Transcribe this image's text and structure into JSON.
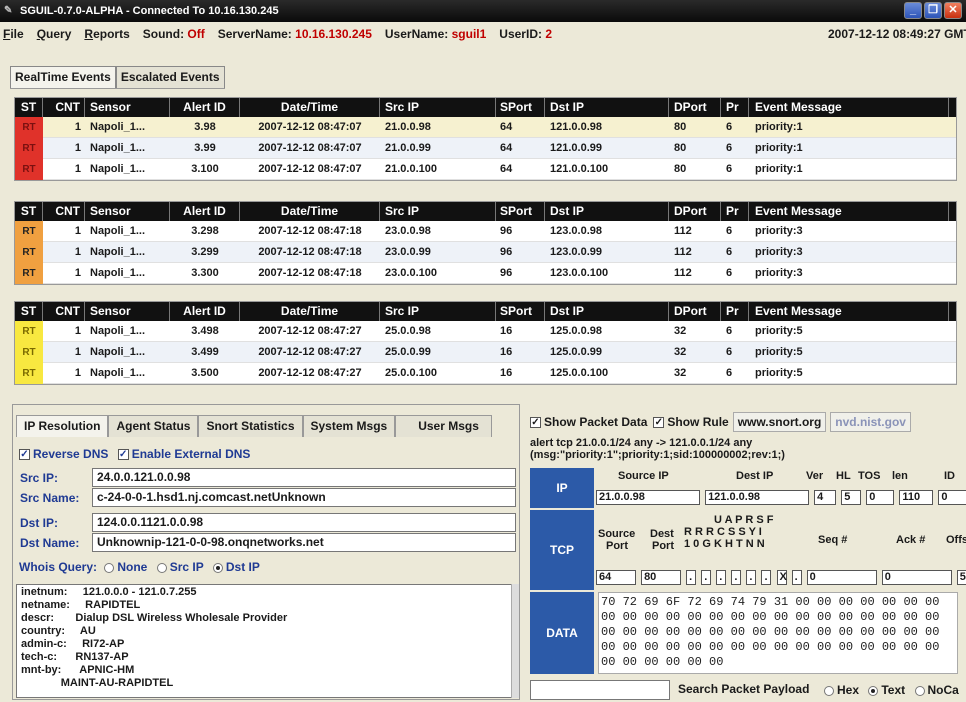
{
  "window": {
    "title": "SGUIL-0.7.0-ALPHA - Connected To 10.16.130.245"
  },
  "menu": {
    "file": "ile",
    "file_u": "F",
    "query": "uery",
    "query_u": "Q",
    "reports": "eports",
    "reports_u": "R",
    "sound_label": "Sound:",
    "sound_value": "Off",
    "server_label": "ServerName:",
    "server_value": "10.16.130.245",
    "user_label": "UserName:",
    "user_value": "sguil1",
    "userid_label": "UserID:",
    "userid_value": "2",
    "clock": "2007-12-12 08:49:27 GMT"
  },
  "tabs": [
    "RealTime Events",
    "Escalated Events"
  ],
  "columns": [
    "ST",
    "CNT",
    "Sensor",
    "Alert ID",
    "Date/Time",
    "Src IP",
    "SPort",
    "Dst IP",
    "DPort",
    "Pr",
    "Event Message"
  ],
  "panes": [
    {
      "color": "#e0322a",
      "rows": [
        {
          "st": "RT",
          "cnt": "1",
          "sensor": "Napoli_1...",
          "alert": "3.98",
          "date": "2007-12-12 08:47:07",
          "src": "21.0.0.98",
          "sport": "64",
          "dst": "121.0.0.98",
          "dport": "80",
          "pr": "6",
          "msg": "priority:1"
        },
        {
          "st": "RT",
          "cnt": "1",
          "sensor": "Napoli_1...",
          "alert": "3.99",
          "date": "2007-12-12 08:47:07",
          "src": "21.0.0.99",
          "sport": "64",
          "dst": "121.0.0.99",
          "dport": "80",
          "pr": "6",
          "msg": "priority:1"
        },
        {
          "st": "RT",
          "cnt": "1",
          "sensor": "Napoli_1...",
          "alert": "3.100",
          "date": "2007-12-12 08:47:07",
          "src": "21.0.0.100",
          "sport": "64",
          "dst": "121.0.0.100",
          "dport": "80",
          "pr": "6",
          "msg": "priority:1"
        }
      ]
    },
    {
      "color": "#f0a040",
      "rows": [
        {
          "st": "RT",
          "cnt": "1",
          "sensor": "Napoli_1...",
          "alert": "3.298",
          "date": "2007-12-12 08:47:18",
          "src": "23.0.0.98",
          "sport": "96",
          "dst": "123.0.0.98",
          "dport": "112",
          "pr": "6",
          "msg": "priority:3"
        },
        {
          "st": "RT",
          "cnt": "1",
          "sensor": "Napoli_1...",
          "alert": "3.299",
          "date": "2007-12-12 08:47:18",
          "src": "23.0.0.99",
          "sport": "96",
          "dst": "123.0.0.99",
          "dport": "112",
          "pr": "6",
          "msg": "priority:3"
        },
        {
          "st": "RT",
          "cnt": "1",
          "sensor": "Napoli_1...",
          "alert": "3.300",
          "date": "2007-12-12 08:47:18",
          "src": "23.0.0.100",
          "sport": "96",
          "dst": "123.0.0.100",
          "dport": "112",
          "pr": "6",
          "msg": "priority:3"
        }
      ]
    },
    {
      "color": "#f8e840",
      "rows": [
        {
          "st": "RT",
          "cnt": "1",
          "sensor": "Napoli_1...",
          "alert": "3.498",
          "date": "2007-12-12 08:47:27",
          "src": "25.0.0.98",
          "sport": "16",
          "dst": "125.0.0.98",
          "dport": "32",
          "pr": "6",
          "msg": "priority:5"
        },
        {
          "st": "RT",
          "cnt": "1",
          "sensor": "Napoli_1...",
          "alert": "3.499",
          "date": "2007-12-12 08:47:27",
          "src": "25.0.0.99",
          "sport": "16",
          "dst": "125.0.0.99",
          "dport": "32",
          "pr": "6",
          "msg": "priority:5"
        },
        {
          "st": "RT",
          "cnt": "1",
          "sensor": "Napoli_1...",
          "alert": "3.500",
          "date": "2007-12-12 08:47:27",
          "src": "25.0.0.100",
          "sport": "16",
          "dst": "125.0.0.100",
          "dport": "32",
          "pr": "6",
          "msg": "priority:5"
        }
      ]
    }
  ],
  "lower_tabs": [
    "IP Resolution",
    "Agent Status",
    "Snort Statistics",
    "System Msgs",
    "User Msgs"
  ],
  "ipres": {
    "reverse_dns": "Reverse DNS",
    "external_dns": "Enable External DNS",
    "src_ip_label": "Src IP:",
    "src_ip": "24.0.0.121.0.0.98",
    "src_name_label": "Src Name:",
    "src_name": "c-24-0-0-1.hsd1.nj.comcast.netUnknown",
    "dst_ip_label": "Dst IP:",
    "dst_ip": "124.0.0.1121.0.0.98",
    "dst_name_label": "Dst Name:",
    "dst_name": "Unknownip-121-0-0-98.onqnetworks.net",
    "whois_label": "Whois Query:",
    "opt_none": "None",
    "opt_src": "Src IP",
    "opt_dst": "Dst IP",
    "whois_lines": [
      "inetnum:     121.0.0.0 - 121.0.7.255",
      "netname:     RAPIDTEL",
      "descr:       Dialup DSL Wireless Wholesale Provider",
      "country:     AU",
      "admin-c:     RI72-AP",
      "tech-c:      RN137-AP",
      "mnt-by:      APNIC-HM",
      "             MAINT-AU-RAPIDTEL"
    ]
  },
  "packet": {
    "show_packet": "Show Packet Data",
    "show_rule": "Show Rule",
    "snort_link": "www.snort.org",
    "nvd_link": "nvd.nist.gov",
    "rule_line1": "alert tcp 21.0.0.1/24 any -> 121.0.0.1/24 any",
    "rule_line2": "(msg:\"priority:1\";priority:1;sid:100000002;rev:1;)",
    "ip_label": "IP",
    "tcp_label": "TCP",
    "data_label": "DATA",
    "ip_headers": [
      "Source IP",
      "Dest IP",
      "Ver",
      "HL",
      "TOS",
      "len",
      "ID"
    ],
    "ip_values": [
      "21.0.0.98",
      "121.0.0.98",
      "4",
      "5",
      "0",
      "110",
      "0"
    ],
    "tcp_headers_top": "U A P R S F",
    "tcp_headers_mid": "R R R C S S Y I",
    "tcp_headers_bot": "1 0 G K H T N N",
    "tcp_src": "Source",
    "tcp_port": "Port",
    "tcp_dest": "Dest",
    "tcp_seq": "Seq #",
    "tcp_ack": "Ack #",
    "tcp_off": "Offse",
    "tcp_values": [
      "64",
      "80",
      ".",
      ".",
      ".",
      ".",
      ".",
      ".",
      "X",
      ".",
      "0",
      "0",
      "5"
    ],
    "hex_lines": [
      "70 72 69 6F 72 69 74 79 31 00 00 00 00 00 00 00",
      "00 00 00 00 00 00 00 00 00 00 00 00 00 00 00 00",
      "00 00 00 00 00 00 00 00 00 00 00 00 00 00 00 00",
      "00 00 00 00 00 00 00 00 00 00 00 00 00 00 00 00",
      "00 00 00 00 00 00"
    ],
    "search_btn": "Search Packet Payload",
    "opt_hex": "Hex",
    "opt_text": "Text",
    "opt_nocase": "NoCa"
  }
}
